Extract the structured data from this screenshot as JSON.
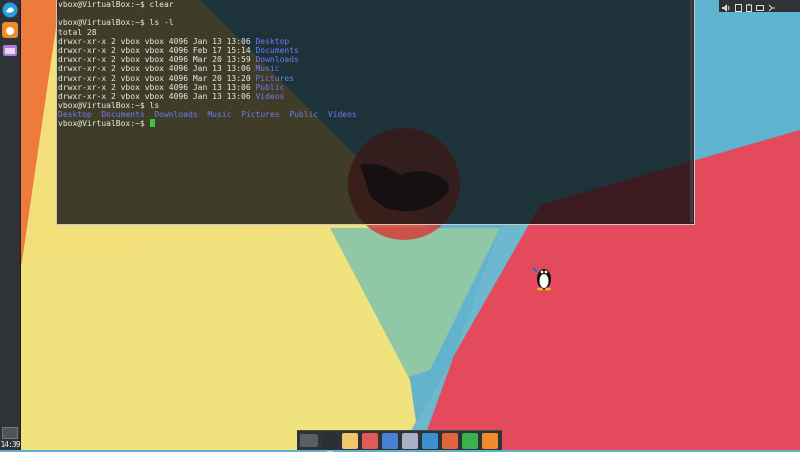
{
  "terminal": {
    "lines": [
      {
        "kind": "text",
        "text": "vbox@VirtualBox:~$ clear"
      },
      {
        "kind": "blank",
        "text": ""
      },
      {
        "kind": "text",
        "text": "vbox@VirtualBox:~$ ls -l"
      },
      {
        "kind": "text",
        "text": "total 28"
      },
      {
        "kind": "entry",
        "meta": "drwxr-xr-x 2 vbox vbox 4096 Jan 13 13:06 ",
        "name": "Desktop"
      },
      {
        "kind": "entry",
        "meta": "drwxr-xr-x 2 vbox vbox 4096 Feb 17 15:14 ",
        "name": "Documents"
      },
      {
        "kind": "entry",
        "meta": "drwxr-xr-x 2 vbox vbox 4096 Mar 20 13:59 ",
        "name": "Downloads"
      },
      {
        "kind": "entry",
        "meta": "drwxr-xr-x 2 vbox vbox 4096 Jan 13 13:06 ",
        "name": "Music"
      },
      {
        "kind": "entry",
        "meta": "drwxr-xr-x 2 vbox vbox 4096 Mar 20 13:20 ",
        "name": "Pictures"
      },
      {
        "kind": "entry",
        "meta": "drwxr-xr-x 2 vbox vbox 4096 Jan 13 13:06 ",
        "name": "Public"
      },
      {
        "kind": "entry",
        "meta": "drwxr-xr-x 2 vbox vbox 4096 Jan 13 13:06 ",
        "name": "Videos"
      },
      {
        "kind": "text",
        "text": "vbox@VirtualBox:~$ ls"
      },
      {
        "kind": "dirs",
        "items": [
          "Desktop",
          "Documents",
          "Downloads",
          "Music",
          "Pictures",
          "Public",
          "Videos"
        ]
      },
      {
        "kind": "prompt",
        "text": "vbox@VirtualBox:~$ "
      }
    ],
    "colors": {
      "text": "#e6e6e6",
      "directory": "#6e7cf0",
      "cursor": "#3ec43e"
    }
  },
  "sidepanel": {
    "items": [
      {
        "icon": "whisker-menu-icon",
        "color": "#2a9fe0"
      },
      {
        "icon": "firefox-icon",
        "color": "#f08a2c"
      },
      {
        "icon": "file-manager-icon",
        "color": "#b07bd0"
      }
    ],
    "clock": "14:39"
  },
  "tray": {
    "icons": [
      "volume-icon",
      "clipboard-icon",
      "battery-icon",
      "display-icon",
      "network-icon"
    ]
  },
  "dock": {
    "items": [
      {
        "icon": "show-desktop-icon",
        "color": "#5a5f66"
      },
      {
        "icon": "system-monitor-icon",
        "color": "#2b2f33"
      },
      {
        "icon": "mail-icon",
        "color": "#f2c46b"
      },
      {
        "icon": "image-viewer-icon",
        "color": "#e05a5a"
      },
      {
        "icon": "screenshot-icon",
        "color": "#4a7fd6"
      },
      {
        "icon": "text-editor-icon",
        "color": "#a8b0c8"
      },
      {
        "icon": "document-icon",
        "color": "#3d8fd0"
      },
      {
        "icon": "presentation-icon",
        "color": "#e0663c"
      },
      {
        "icon": "spreadsheet-icon",
        "color": "#3cb04a"
      },
      {
        "icon": "media-player-icon",
        "color": "#f08a2c"
      }
    ]
  }
}
